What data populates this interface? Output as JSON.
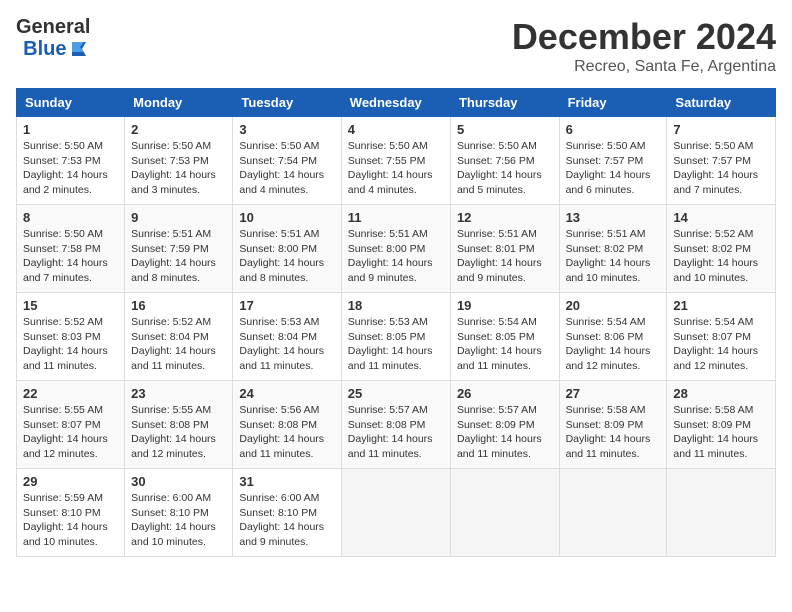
{
  "header": {
    "logo_general": "General",
    "logo_blue": "Blue",
    "month_title": "December 2024",
    "location": "Recreo, Santa Fe, Argentina"
  },
  "days_of_week": [
    "Sunday",
    "Monday",
    "Tuesday",
    "Wednesday",
    "Thursday",
    "Friday",
    "Saturday"
  ],
  "weeks": [
    [
      {
        "day": "1",
        "sunrise": "5:50 AM",
        "sunset": "7:53 PM",
        "daylight": "14 hours and 2 minutes."
      },
      {
        "day": "2",
        "sunrise": "5:50 AM",
        "sunset": "7:53 PM",
        "daylight": "14 hours and 3 minutes."
      },
      {
        "day": "3",
        "sunrise": "5:50 AM",
        "sunset": "7:54 PM",
        "daylight": "14 hours and 4 minutes."
      },
      {
        "day": "4",
        "sunrise": "5:50 AM",
        "sunset": "7:55 PM",
        "daylight": "14 hours and 4 minutes."
      },
      {
        "day": "5",
        "sunrise": "5:50 AM",
        "sunset": "7:56 PM",
        "daylight": "14 hours and 5 minutes."
      },
      {
        "day": "6",
        "sunrise": "5:50 AM",
        "sunset": "7:57 PM",
        "daylight": "14 hours and 6 minutes."
      },
      {
        "day": "7",
        "sunrise": "5:50 AM",
        "sunset": "7:57 PM",
        "daylight": "14 hours and 7 minutes."
      }
    ],
    [
      {
        "day": "8",
        "sunrise": "5:50 AM",
        "sunset": "7:58 PM",
        "daylight": "14 hours and 7 minutes."
      },
      {
        "day": "9",
        "sunrise": "5:51 AM",
        "sunset": "7:59 PM",
        "daylight": "14 hours and 8 minutes."
      },
      {
        "day": "10",
        "sunrise": "5:51 AM",
        "sunset": "8:00 PM",
        "daylight": "14 hours and 8 minutes."
      },
      {
        "day": "11",
        "sunrise": "5:51 AM",
        "sunset": "8:00 PM",
        "daylight": "14 hours and 9 minutes."
      },
      {
        "day": "12",
        "sunrise": "5:51 AM",
        "sunset": "8:01 PM",
        "daylight": "14 hours and 9 minutes."
      },
      {
        "day": "13",
        "sunrise": "5:51 AM",
        "sunset": "8:02 PM",
        "daylight": "14 hours and 10 minutes."
      },
      {
        "day": "14",
        "sunrise": "5:52 AM",
        "sunset": "8:02 PM",
        "daylight": "14 hours and 10 minutes."
      }
    ],
    [
      {
        "day": "15",
        "sunrise": "5:52 AM",
        "sunset": "8:03 PM",
        "daylight": "14 hours and 11 minutes."
      },
      {
        "day": "16",
        "sunrise": "5:52 AM",
        "sunset": "8:04 PM",
        "daylight": "14 hours and 11 minutes."
      },
      {
        "day": "17",
        "sunrise": "5:53 AM",
        "sunset": "8:04 PM",
        "daylight": "14 hours and 11 minutes."
      },
      {
        "day": "18",
        "sunrise": "5:53 AM",
        "sunset": "8:05 PM",
        "daylight": "14 hours and 11 minutes."
      },
      {
        "day": "19",
        "sunrise": "5:54 AM",
        "sunset": "8:05 PM",
        "daylight": "14 hours and 11 minutes."
      },
      {
        "day": "20",
        "sunrise": "5:54 AM",
        "sunset": "8:06 PM",
        "daylight": "14 hours and 12 minutes."
      },
      {
        "day": "21",
        "sunrise": "5:54 AM",
        "sunset": "8:07 PM",
        "daylight": "14 hours and 12 minutes."
      }
    ],
    [
      {
        "day": "22",
        "sunrise": "5:55 AM",
        "sunset": "8:07 PM",
        "daylight": "14 hours and 12 minutes."
      },
      {
        "day": "23",
        "sunrise": "5:55 AM",
        "sunset": "8:08 PM",
        "daylight": "14 hours and 12 minutes."
      },
      {
        "day": "24",
        "sunrise": "5:56 AM",
        "sunset": "8:08 PM",
        "daylight": "14 hours and 11 minutes."
      },
      {
        "day": "25",
        "sunrise": "5:57 AM",
        "sunset": "8:08 PM",
        "daylight": "14 hours and 11 minutes."
      },
      {
        "day": "26",
        "sunrise": "5:57 AM",
        "sunset": "8:09 PM",
        "daylight": "14 hours and 11 minutes."
      },
      {
        "day": "27",
        "sunrise": "5:58 AM",
        "sunset": "8:09 PM",
        "daylight": "14 hours and 11 minutes."
      },
      {
        "day": "28",
        "sunrise": "5:58 AM",
        "sunset": "8:09 PM",
        "daylight": "14 hours and 11 minutes."
      }
    ],
    [
      {
        "day": "29",
        "sunrise": "5:59 AM",
        "sunset": "8:10 PM",
        "daylight": "14 hours and 10 minutes."
      },
      {
        "day": "30",
        "sunrise": "6:00 AM",
        "sunset": "8:10 PM",
        "daylight": "14 hours and 10 minutes."
      },
      {
        "day": "31",
        "sunrise": "6:00 AM",
        "sunset": "8:10 PM",
        "daylight": "14 hours and 9 minutes."
      },
      null,
      null,
      null,
      null
    ]
  ]
}
